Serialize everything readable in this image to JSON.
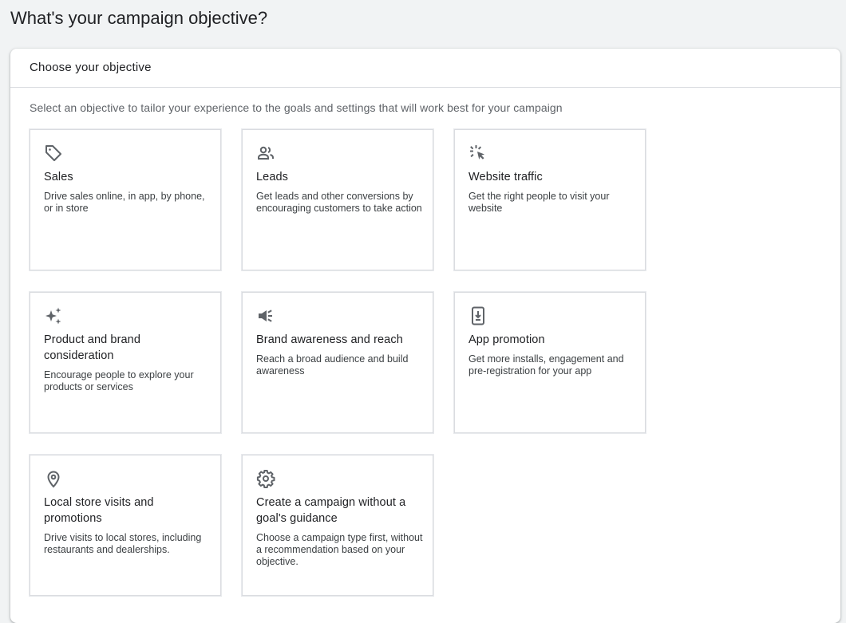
{
  "page": {
    "title": "What's your campaign objective?"
  },
  "panel": {
    "title": "Choose your objective",
    "subtitle": "Select an objective to tailor your experience to the goals and settings that will work best for your campaign"
  },
  "objectives": [
    {
      "icon": "tag-icon",
      "title": "Sales",
      "description": "Drive sales online, in app, by phone, or in store"
    },
    {
      "icon": "people-icon",
      "title": "Leads",
      "description": "Get leads and other conversions by encouraging customers to take action"
    },
    {
      "icon": "cursor-click-icon",
      "title": "Website traffic",
      "description": "Get the right people to visit your website"
    },
    {
      "icon": "sparkle-icon",
      "title": "Product and brand consideration",
      "description": "Encourage people to explore your products or services"
    },
    {
      "icon": "megaphone-icon",
      "title": "Brand awareness and reach",
      "description": "Reach a broad audience and build awareness"
    },
    {
      "icon": "phone-download-icon",
      "title": "App promotion",
      "description": "Get more installs, engagement and pre-registration for your app"
    },
    {
      "icon": "location-pin-icon",
      "title": "Local store visits and promotions",
      "description": "Drive visits to local stores, including restaurants and dealerships."
    },
    {
      "icon": "gear-icon",
      "title": "Create a campaign without a goal's guidance",
      "description": "Choose a campaign type first, without a recommendation based on your objective."
    }
  ]
}
